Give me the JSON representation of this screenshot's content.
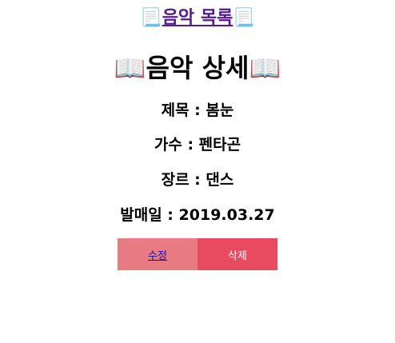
{
  "nav": {
    "icon": "📃",
    "music_list_link": "음악 목록"
  },
  "detail": {
    "icon": "📖",
    "heading": "음악 상세",
    "title_label": "제목 : ",
    "title_value": "봄눈",
    "artist_label": "가수 : ",
    "artist_value": "펜타곤",
    "genre_label": "장르 : ",
    "genre_value": "댄스",
    "release_label": "발매일 : ",
    "release_value": "2019.03.27"
  },
  "actions": {
    "edit_label": "수정",
    "delete_label": "삭제"
  },
  "colors": {
    "edit_bg": "#e87a82",
    "delete_bg": "#e84a5f",
    "link": "#551a8b"
  }
}
